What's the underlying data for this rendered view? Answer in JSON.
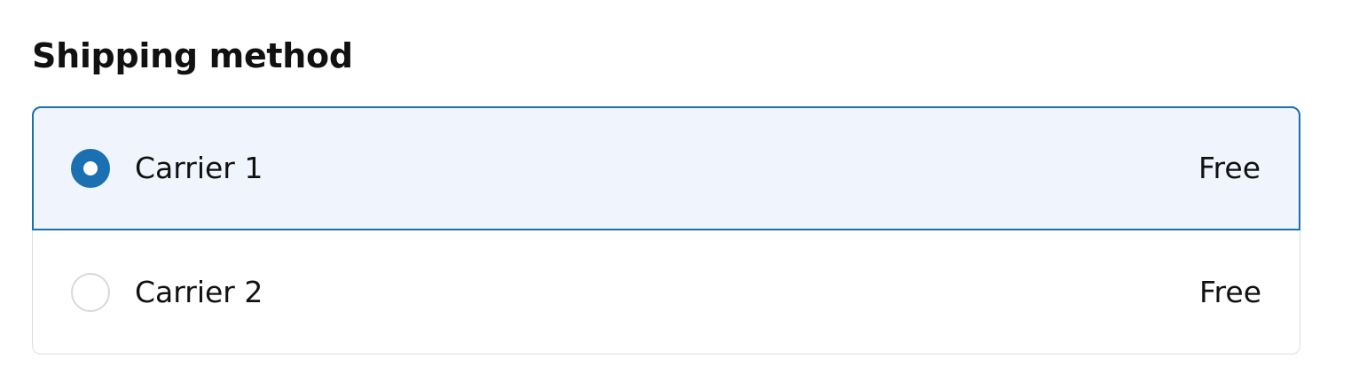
{
  "shipping": {
    "title": "Shipping method",
    "options": [
      {
        "label": "Carrier 1",
        "price": "Free",
        "selected": true
      },
      {
        "label": "Carrier 2",
        "price": "Free",
        "selected": false
      }
    ]
  },
  "colors": {
    "accent": "#1a70b0",
    "selected_background": "#f0f5fd",
    "border": "#dedede"
  }
}
